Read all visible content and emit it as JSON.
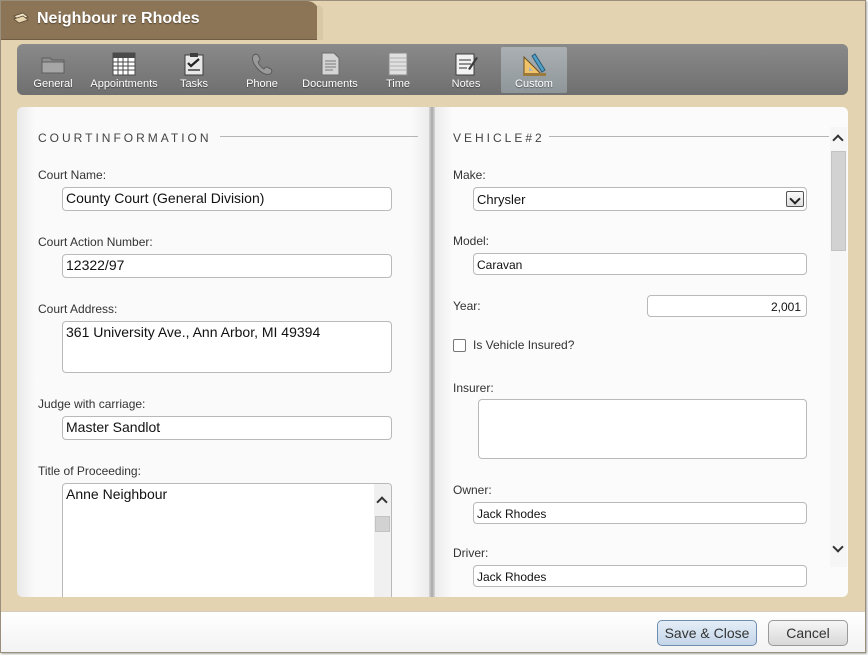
{
  "window": {
    "title": "Neighbour re Rhodes"
  },
  "toolbar": {
    "items": [
      {
        "label": "General",
        "icon": "folder-icon"
      },
      {
        "label": "Appointments",
        "icon": "calendar-icon"
      },
      {
        "label": "Tasks",
        "icon": "clipboard-icon"
      },
      {
        "label": "Phone",
        "icon": "phone-icon"
      },
      {
        "label": "Documents",
        "icon": "document-icon"
      },
      {
        "label": "Time",
        "icon": "timesheet-icon"
      },
      {
        "label": "Notes",
        "icon": "notepad-icon"
      },
      {
        "label": "Custom",
        "icon": "drafting-tools-icon"
      }
    ],
    "active": "Custom"
  },
  "court": {
    "section_title": "COURTINFORMATION",
    "court_name": {
      "label": "Court Name:",
      "value": "County Court (General Division)"
    },
    "action_number": {
      "label": "Court Action Number:",
      "value": "12322/97"
    },
    "address": {
      "label": "Court Address:",
      "value": "361 University Ave., Ann Arbor, MI 49394"
    },
    "judge": {
      "label": "Judge with carriage:",
      "value": "Master Sandlot"
    },
    "proceeding": {
      "label": "Title of Proceeding:",
      "value": "Anne Neighbour"
    }
  },
  "vehicle": {
    "section_title": "VEHICLE#2",
    "make": {
      "label": "Make:",
      "value": "Chrysler"
    },
    "model": {
      "label": "Model:",
      "value": "Caravan"
    },
    "year": {
      "label": "Year:",
      "value": "2,001"
    },
    "insured": {
      "label": "Is Vehicle Insured?",
      "checked": false
    },
    "insurer": {
      "label": "Insurer:",
      "value": ""
    },
    "owner": {
      "label": "Owner:",
      "value": "Jack Rhodes"
    },
    "driver": {
      "label": "Driver:",
      "value": "Jack Rhodes"
    }
  },
  "footer": {
    "save_label": "Save & Close",
    "cancel_label": "Cancel"
  },
  "colors": {
    "frame": "#e3d3b0",
    "title_tab": "#8c7557",
    "toolbar": "#7a7a7a",
    "active_tab": "#9fa6a9"
  }
}
